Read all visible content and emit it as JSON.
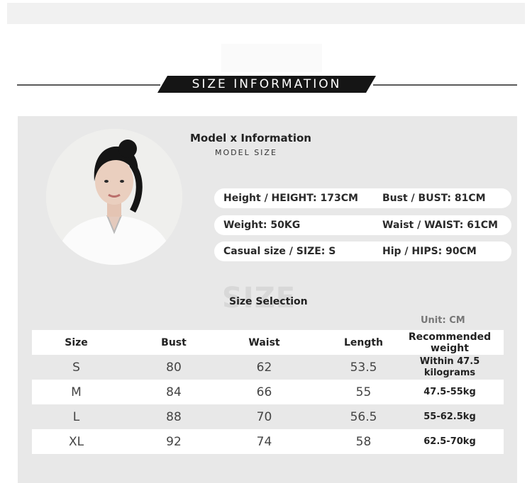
{
  "banner": {
    "title": "SIZE INFORMATION"
  },
  "model": {
    "heading": "Model x Information",
    "subheading": "MODEL SIZE",
    "info_rows": [
      {
        "left": "Height / HEIGHT: 173CM",
        "right": "Bust / BUST: 81CM"
      },
      {
        "left": "Weight: 50KG",
        "right": "Waist / WAIST: 61CM"
      },
      {
        "left": "Casual size / SIZE: S",
        "right": "Hip / HIPS: 90CM"
      }
    ]
  },
  "size_table": {
    "watermark": "SIZE",
    "title": "Size Selection",
    "unit": "Unit: CM",
    "headers": [
      "Size",
      "Bust",
      "Waist",
      "Length",
      "Recommended weight"
    ],
    "rows": [
      [
        "S",
        "80",
        "62",
        "53.5",
        "Within 47.5 kilograms"
      ],
      [
        "M",
        "84",
        "66",
        "55",
        "47.5-55kg"
      ],
      [
        "L",
        "88",
        "70",
        "56.5",
        "55-62.5kg"
      ],
      [
        "XL",
        "92",
        "74",
        "58",
        "62.5-70kg"
      ]
    ]
  },
  "colors": {
    "banner": "#151515",
    "panel": "#e8e8e8",
    "row_highlight": "#ffffff"
  }
}
